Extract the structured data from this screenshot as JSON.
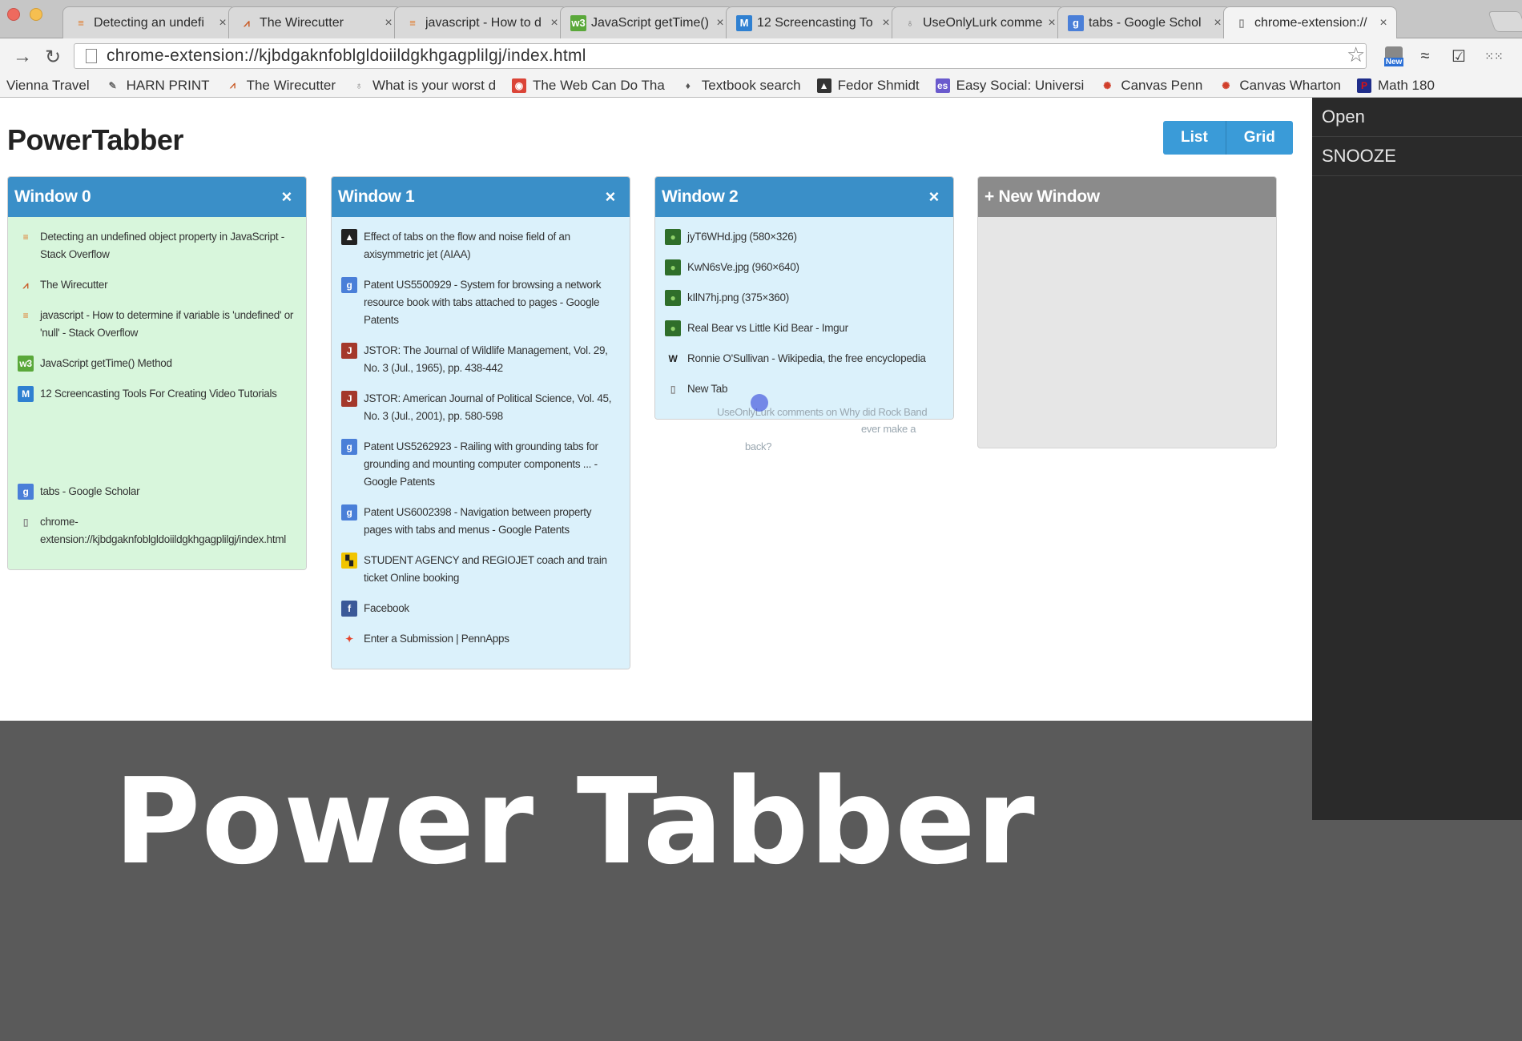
{
  "browser": {
    "tabs": [
      {
        "label": "Detecting an undefi",
        "icon": "stackoverflow-icon",
        "active": false
      },
      {
        "label": "The Wirecutter",
        "icon": "wirecutter-icon",
        "active": false
      },
      {
        "label": "javascript - How to d",
        "icon": "stackoverflow-icon",
        "active": false
      },
      {
        "label": "JavaScript getTime()",
        "icon": "w3schools-icon",
        "active": false
      },
      {
        "label": "12 Screencasting To",
        "icon": "m-icon",
        "active": false
      },
      {
        "label": "UseOnlyLurk comme",
        "icon": "lightbulb-icon",
        "active": false
      },
      {
        "label": "tabs - Google Schol",
        "icon": "google-scholar-icon",
        "active": false
      },
      {
        "label": "chrome-extension://",
        "icon": "page-icon",
        "active": true
      }
    ],
    "close_glyph": "×",
    "address": "chrome-extension://kjbdgaknfoblgldoiildgkhgagplilgj/index.html",
    "ext_badge": "New",
    "bookmarks": [
      {
        "label": "Vienna Travel",
        "icon": ""
      },
      {
        "label": "HARN PRINT",
        "icon": "harn-icon"
      },
      {
        "label": "The Wirecutter",
        "icon": "wirecutter-icon"
      },
      {
        "label": "What is your worst d",
        "icon": "lightbulb-icon"
      },
      {
        "label": "The Web Can Do Tha",
        "icon": "chrome-icon"
      },
      {
        "label": "Textbook search",
        "icon": "textbook-icon"
      },
      {
        "label": "Fedor Shmidt",
        "icon": "fedor-icon"
      },
      {
        "label": "Easy Social: Universi",
        "icon": "es-icon"
      },
      {
        "label": "Canvas Penn",
        "icon": "canvas-icon"
      },
      {
        "label": "Canvas Wharton",
        "icon": "canvas-icon"
      },
      {
        "label": "Math 180",
        "icon": "p-icon"
      }
    ]
  },
  "app": {
    "title": "PowerTabber",
    "view_list": "List",
    "view_grid": "Grid",
    "close_glyph": "×",
    "windows": [
      {
        "title": "Window 0",
        "color": "green",
        "tabs": [
          {
            "icon": "stackoverflow-icon",
            "title": "Detecting an undefined object property in JavaScript - Stack Overflow"
          },
          {
            "icon": "wirecutter-icon",
            "title": "The Wirecutter"
          },
          {
            "icon": "stackoverflow-icon",
            "title": "javascript - How to determine if variable is 'undefined' or 'null' - Stack Overflow"
          },
          {
            "icon": "w3schools-icon",
            "title": "JavaScript getTime() Method"
          },
          {
            "icon": "m-icon",
            "title": "12 Screencasting Tools For Creating Video Tutorials"
          },
          {
            "icon": "google-scholar-icon",
            "title": "tabs - Google Scholar"
          },
          {
            "icon": "page-icon",
            "title": "chrome-extension://kjbdgaknfoblgldoiildgkhgagplilgj/index.html"
          }
        ]
      },
      {
        "title": "Window 1",
        "color": "blue",
        "tabs": [
          {
            "icon": "aiaa-icon",
            "title": "Effect of tabs on the flow and noise field of an axisymmetric jet (AIAA)"
          },
          {
            "icon": "google-icon",
            "title": "Patent US5500929 - System for browsing a network resource book with tabs attached to pages - Google Patents"
          },
          {
            "icon": "jstor-icon",
            "title": "JSTOR: The Journal of Wildlife Management, Vol. 29, No. 3 (Jul., 1965), pp. 438-442"
          },
          {
            "icon": "jstor-icon",
            "title": "JSTOR: American Journal of Political Science, Vol. 45, No. 3 (Jul., 2001), pp. 580-598"
          },
          {
            "icon": "google-icon",
            "title": "Patent US5262923 - Railing with grounding tabs for grounding and mounting computer components ... - Google Patents"
          },
          {
            "icon": "google-icon",
            "title": "Patent US6002398 - Navigation between property pages with tabs and menus - Google Patents"
          },
          {
            "icon": "student-agency-icon",
            "title": "STUDENT AGENCY and REGIOJET coach and train ticket Online booking"
          },
          {
            "icon": "facebook-icon",
            "title": "Facebook"
          },
          {
            "icon": "pennapps-icon",
            "title": "Enter a Submission | PennApps"
          }
        ]
      },
      {
        "title": "Window 2",
        "color": "blue",
        "tabs": [
          {
            "icon": "image-icon",
            "title": "jyT6WHd.jpg (580×326)"
          },
          {
            "icon": "image-icon",
            "title": "KwN6sVe.jpg (960×640)"
          },
          {
            "icon": "image-icon",
            "title": "kIlN7hj.png (375×360)"
          },
          {
            "icon": "image-icon",
            "title": "Real Bear vs Little Kid Bear - Imgur"
          },
          {
            "icon": "wikipedia-icon",
            "title": "Ronnie O'Sullivan - Wikipedia, the free encyclopedia"
          },
          {
            "icon": "page-icon",
            "title": "New Tab"
          }
        ]
      }
    ],
    "new_window": "+ New Window",
    "drag_ghost": {
      "line1": "UseOnlyLurk comments on Why did Rock Band",
      "line2": "ever make a",
      "line3": "back?"
    }
  },
  "sidepanel": {
    "items": [
      "Open",
      "SNOOZE"
    ]
  },
  "caption": "Power Tabber"
}
